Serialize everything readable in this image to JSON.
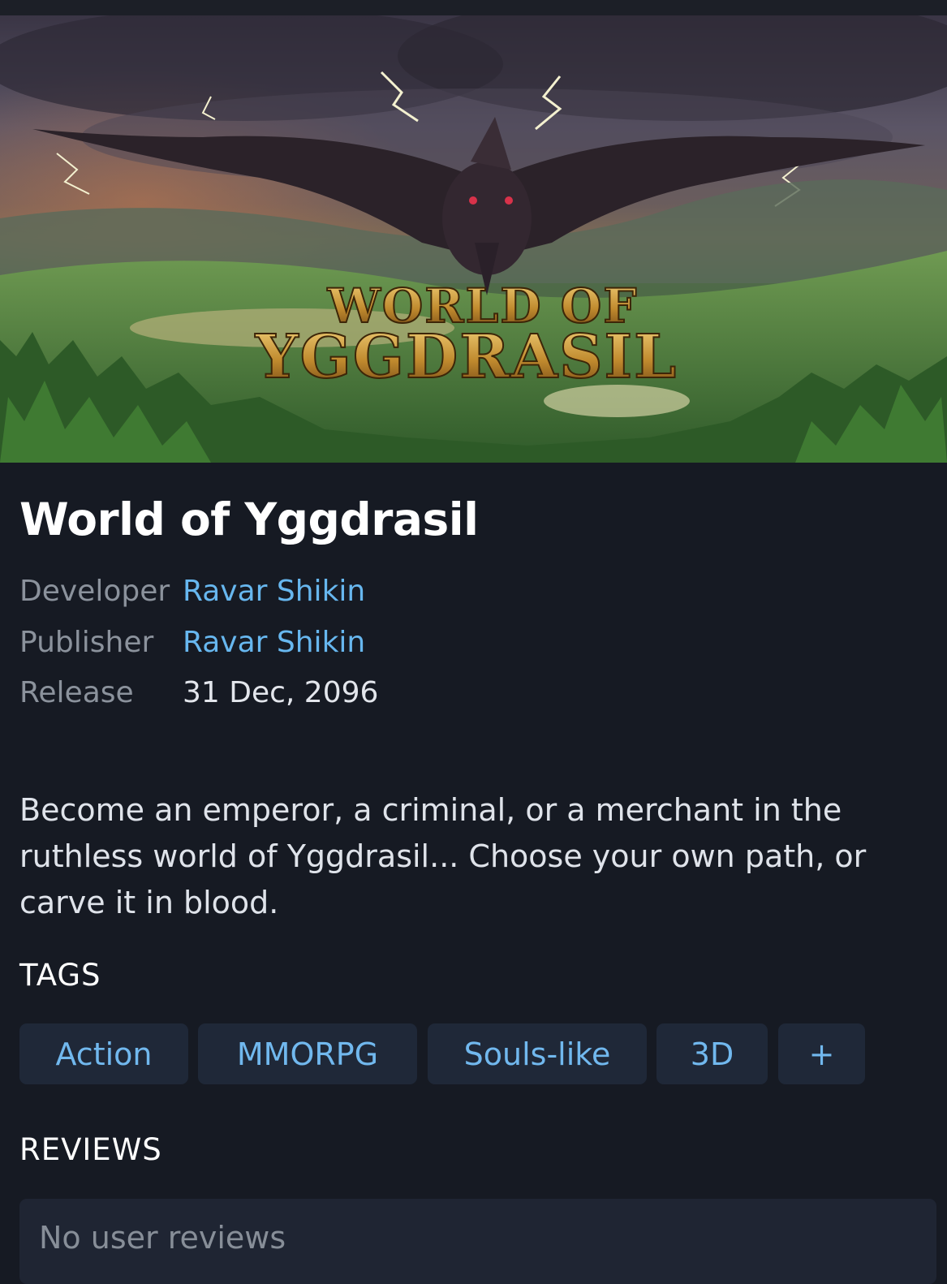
{
  "hero": {
    "logo_line1": "WORLD OF",
    "logo_line2": "YGGDRASIL"
  },
  "game": {
    "title": "World of Yggdrasil",
    "description": "Become an emperor, a criminal, or a merchant in the ruthless world of Yggdrasil... Choose your own path, or carve it in blood."
  },
  "details": [
    {
      "label": "Developer",
      "value": "Ravar Shikin"
    },
    {
      "label": "Publisher",
      "value": "Ravar Shikin"
    },
    {
      "label": "Release",
      "value": "31 Dec, 2096"
    }
  ],
  "tags": {
    "heading": "TAGS",
    "items": [
      "Action",
      "MMORPG",
      "Souls-like",
      "3D",
      "+"
    ]
  },
  "reviews": {
    "heading": "REVIEWS",
    "empty_text": "No user reviews"
  },
  "colors": {
    "background": "#161a23",
    "link": "#67b7ef",
    "tag_background": "#1f2838",
    "review_box": "#1f2533"
  }
}
